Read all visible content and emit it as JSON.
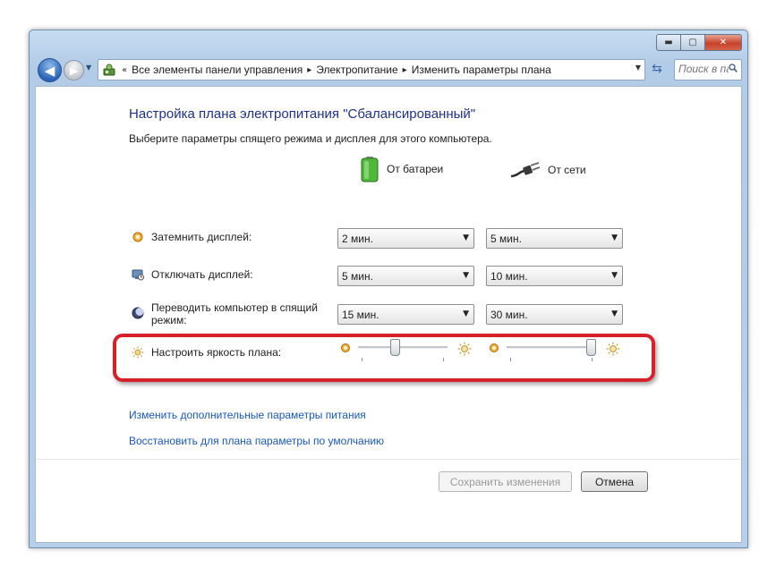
{
  "window": {
    "controls": {
      "minimize": "▬",
      "maximize": "▢",
      "close": "✕"
    }
  },
  "navbar": {
    "back": "◀",
    "forward": "▶",
    "recent": "▼",
    "breadcrumb_sep": "«",
    "crumb_sep": "▸",
    "breadcrumbs": [
      "Все элементы панели управления",
      "Электропитание",
      "Изменить параметры плана"
    ],
    "address_dropdown": "▼",
    "refresh": "⇆",
    "search_placeholder": "Поиск в па..."
  },
  "page": {
    "title": "Настройка плана электропитания \"Сбалансированный\"",
    "subtitle": "Выберите параметры спящего режима и дисплея для этого компьютера.",
    "columns": {
      "battery": "От батареи",
      "plugged": "От сети"
    }
  },
  "settings": {
    "dim_display": {
      "label": "Затемнить дисплей:",
      "battery": "2 мин.",
      "plugged": "5 мин."
    },
    "turn_off_display": {
      "label": "Отключать дисплей:",
      "battery": "5 мин.",
      "plugged": "10 мин."
    },
    "sleep": {
      "label_line1": "Переводить компьютер в спящий",
      "label_line2": "режим:",
      "battery": "15 мин.",
      "plugged": "30 мин."
    },
    "brightness": {
      "label": "Настроить яркость плана:",
      "battery_level": 0.4,
      "plugged_level": 1.0
    }
  },
  "select_arrow": "▼",
  "links": {
    "advanced": "Изменить дополнительные параметры питания",
    "restore": "Восстановить для плана параметры по умолчанию"
  },
  "buttons": {
    "save": "Сохранить изменения",
    "cancel": "Отмена"
  },
  "colors": {
    "title": "#1e3287",
    "link": "#1a58b6",
    "highlight": "#d7202a"
  },
  "icons": [
    "back-arrow-icon",
    "forward-arrow-icon",
    "control-panel-icon",
    "refresh-icon",
    "search-icon",
    "battery-icon",
    "power-plug-icon",
    "dim-display-icon",
    "display-off-icon",
    "sleep-moon-icon",
    "brightness-sun-icon"
  ]
}
